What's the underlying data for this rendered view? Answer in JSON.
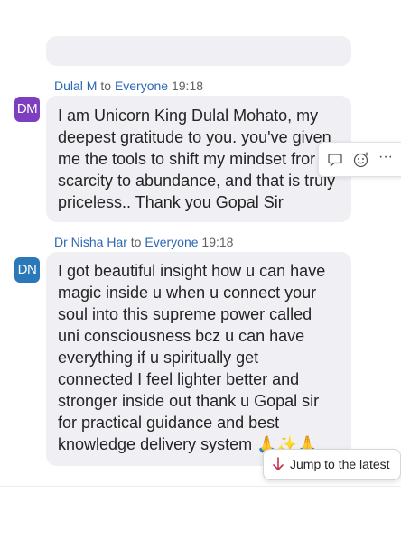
{
  "messages": [
    {
      "sender": "Dulal M",
      "to_word": "to",
      "recipient": "Everyone",
      "time": "19:18",
      "initials": "DM",
      "lines": [
        "I  am Unicorn King Dulal Mohato, my",
        "deepest gratitude to you. you've given",
        "me the tools to shift my mindset fror",
        "scarcity to abundance, and that is truly",
        "priceless.. Thank you Gopal Sir"
      ]
    },
    {
      "sender": "Dr Nisha Har",
      "to_word": "to",
      "recipient": "Everyone",
      "time": "19:18",
      "initials": "DN",
      "lines": [
        "I got beautiful insight how u can have",
        "magic inside u when u connect your",
        "soul into this supreme power called",
        "uni consciousness bcz u can have",
        "everything if u spiritually get",
        "connected I feel lighter better and",
        "stronger inside out thank u Gopal sir",
        "for practical guidance and best",
        "knowledge delivery system"
      ],
      "emojis": [
        "🙏",
        "✨",
        "🙏"
      ]
    }
  ],
  "hover_actions": {
    "icons": [
      "reply-icon",
      "react-icon",
      "more-options-icon"
    ],
    "more_label": "···"
  },
  "jump_button": {
    "label": "Jump to the latest",
    "icon": "arrow-down-icon"
  },
  "colors": {
    "accent": "#2c68b4",
    "bubble": "#f0f0f4",
    "avatar_dm": "#7d3fbf",
    "avatar_dn": "#2a78b8",
    "arrow": "#c4314b"
  }
}
